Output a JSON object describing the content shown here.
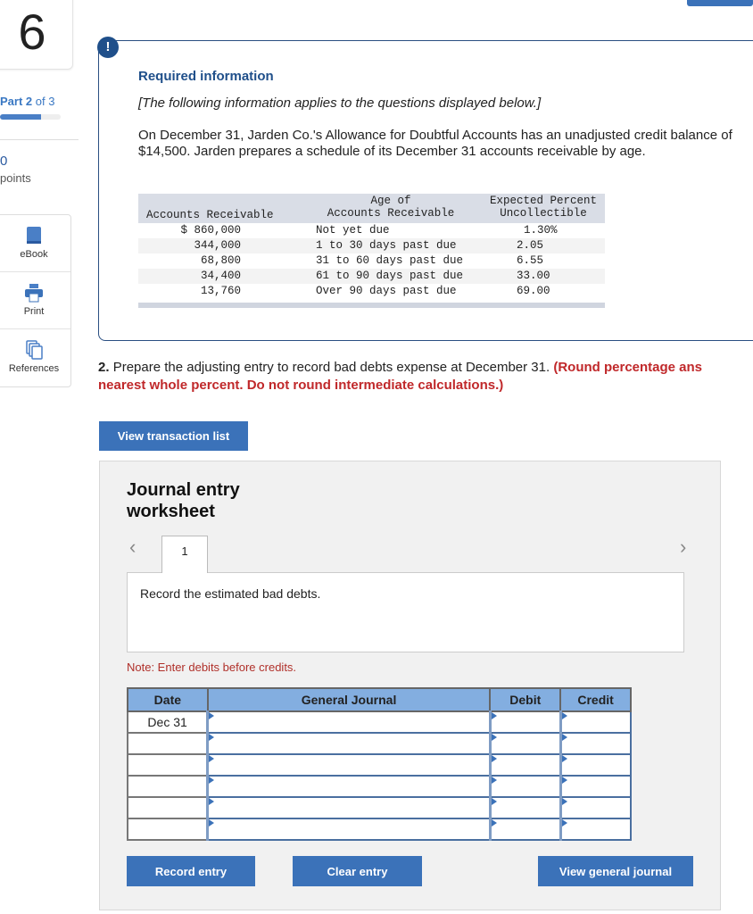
{
  "sidebar": {
    "question_number": "6",
    "part_label": "Part",
    "part_current": "2",
    "part_of": "of 3",
    "progress_percent": 67,
    "points_value": "0",
    "points_label": "points",
    "tools": [
      {
        "label": "eBook",
        "icon": "book-icon"
      },
      {
        "label": "Print",
        "icon": "printer-icon"
      },
      {
        "label": "References",
        "icon": "copy-icon"
      }
    ]
  },
  "info": {
    "badge": "!",
    "title": "Required information",
    "subtitle": "[The following information applies to the questions displayed below.]",
    "paragraph": "On December 31, Jarden Co.'s Allowance for Doubtful Accounts has an unadjusted credit balance of $14,500. Jarden prepares a schedule of its December 31 accounts receivable by age.",
    "table": {
      "headers": [
        "Accounts Receivable",
        "Age of\nAccounts Receivable",
        "Expected Percent\nUncollectible"
      ],
      "rows": [
        [
          "$ 860,000",
          "Not yet due",
          "1.30%"
        ],
        [
          "344,000",
          "1 to 30 days past due",
          "2.05"
        ],
        [
          "68,800",
          "31 to 60 days past due",
          "6.55"
        ],
        [
          "34,400",
          "61 to 90 days past due",
          "33.00"
        ],
        [
          "13,760",
          "Over 90 days past due",
          "69.00"
        ]
      ]
    }
  },
  "question": {
    "number": "2.",
    "text": "Prepare the adjusting entry to record bad debts expense at December 31.",
    "instruction_line1": "(Round percentage ans",
    "instruction_line2": "nearest whole percent. Do not round intermediate calculations.)"
  },
  "view_transaction_list": "View transaction list",
  "worksheet": {
    "title_line1": "Journal entry",
    "title_line2": "worksheet",
    "tab": "1",
    "instruction": "Record the estimated bad debts.",
    "note": "Note: Enter debits before credits.",
    "columns": [
      "Date",
      "General Journal",
      "Debit",
      "Credit"
    ],
    "rows": [
      {
        "date": "Dec 31",
        "account": "",
        "debit": "",
        "credit": ""
      },
      {
        "date": "",
        "account": "",
        "debit": "",
        "credit": ""
      },
      {
        "date": "",
        "account": "",
        "debit": "",
        "credit": ""
      },
      {
        "date": "",
        "account": "",
        "debit": "",
        "credit": ""
      },
      {
        "date": "",
        "account": "",
        "debit": "",
        "credit": ""
      },
      {
        "date": "",
        "account": "",
        "debit": "",
        "credit": ""
      }
    ],
    "buttons": {
      "record": "Record entry",
      "clear": "Clear entry",
      "view_journal": "View general journal"
    }
  },
  "colors": {
    "accent": "#3b72b9",
    "dark_blue": "#1f4f8a",
    "red": "#c0282a",
    "header_blue": "#83aee0"
  }
}
